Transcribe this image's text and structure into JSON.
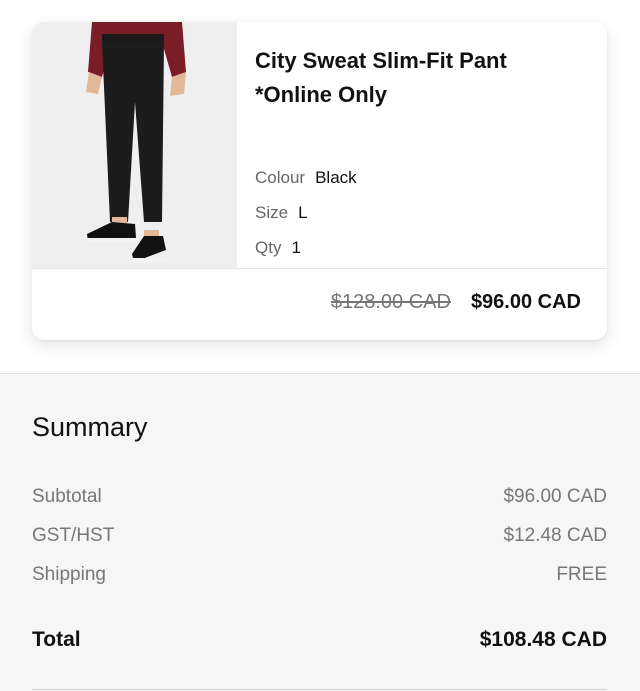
{
  "cart_item": {
    "name": "City Sweat Slim-Fit Pant *Online Only",
    "colour_label": "Colour",
    "colour_value": "Black",
    "size_label": "Size",
    "size_value": "L",
    "qty_label": "Qty",
    "qty_value": "1",
    "original_price": "$128.00 CAD",
    "sale_price": "$96.00 CAD"
  },
  "summary": {
    "title": "Summary",
    "subtotal_label": "Subtotal",
    "subtotal_value": "$96.00 CAD",
    "tax_label": "GST/HST",
    "tax_value": "$12.48 CAD",
    "shipping_label": "Shipping",
    "shipping_value": "FREE",
    "total_label": "Total",
    "total_value": "$108.48 CAD"
  }
}
